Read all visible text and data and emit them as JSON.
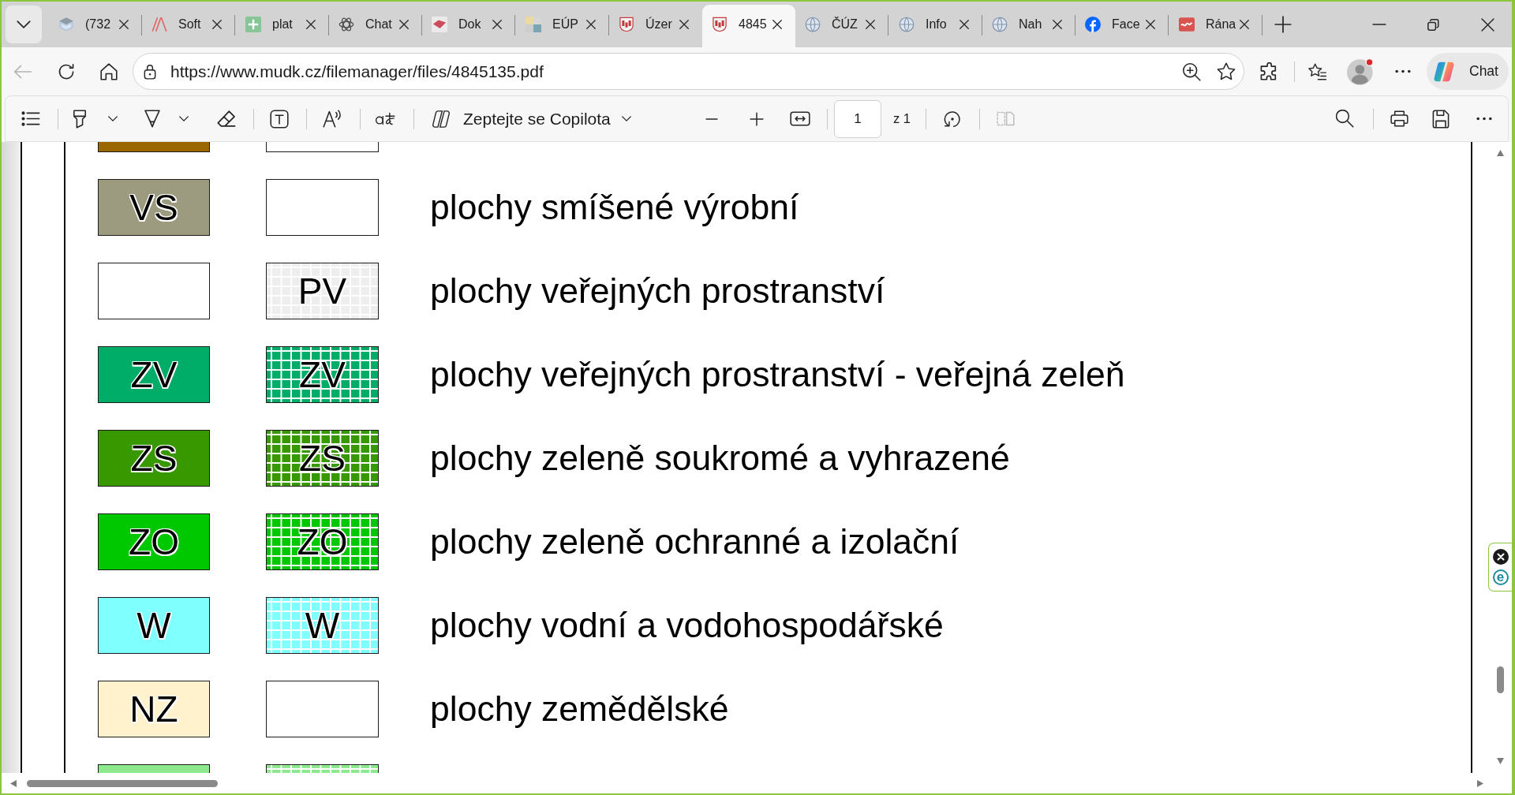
{
  "tabs": [
    {
      "title": "(732",
      "kind": "cube",
      "selected": false
    },
    {
      "title": "Soft",
      "kind": "stripes",
      "selected": false
    },
    {
      "title": "plat",
      "kind": "sheet",
      "selected": false
    },
    {
      "title": "Chat",
      "kind": "knot",
      "selected": false
    },
    {
      "title": "Dok",
      "kind": "wedge",
      "selected": false
    },
    {
      "title": "EÚP",
      "kind": "squares",
      "selected": false
    },
    {
      "title": "Úzer",
      "kind": "crest",
      "selected": false
    },
    {
      "title": "4845",
      "kind": "crest",
      "selected": true
    },
    {
      "title": "ČÚZ",
      "kind": "globe",
      "selected": false
    },
    {
      "title": "Info",
      "kind": "globe",
      "selected": false
    },
    {
      "title": "Nah",
      "kind": "globe",
      "selected": false
    },
    {
      "title": "Face",
      "kind": "f",
      "selected": false
    },
    {
      "title": "Rána",
      "kind": "tile",
      "selected": false
    }
  ],
  "address_bar": {
    "back_disabled": true,
    "url": "https://www.mudk.cz/filemanager/files/4845135.pdf"
  },
  "profile": {
    "notification": true
  },
  "chat_button": {
    "label": "Chat"
  },
  "pdf_toolbar": {
    "copilot_button": {
      "label": "Zeptejte se Copilota"
    },
    "page_field": {
      "value": "1"
    },
    "page_total": "z 1",
    "two_page_disabled": true
  },
  "legend": {
    "rows": [
      {
        "left_box": {
          "kind": "solid",
          "color": "#996600"
        },
        "right_box": {
          "kind": "blank"
        }
      },
      {
        "left_box": {
          "kind": "solid",
          "color": "#9c9a7f",
          "code": "VS"
        },
        "right_box": {
          "kind": "blank"
        },
        "label": "plochy smíšené výrobní"
      },
      {
        "left_box": {
          "kind": "blank"
        },
        "right_box": {
          "kind": "grid",
          "color": "#eeeeee",
          "code": "PV"
        },
        "label": "plochy veřejných prostranství"
      },
      {
        "left_box": {
          "kind": "solid",
          "color": "#00ad68",
          "code": "ZV"
        },
        "right_box": {
          "kind": "grid",
          "color": "#00ad68",
          "code": "ZV"
        },
        "label": "plochy veřejných prostranství - veřejná zeleň"
      },
      {
        "left_box": {
          "kind": "solid",
          "color": "#379800",
          "code": "ZS"
        },
        "right_box": {
          "kind": "grid",
          "color": "#379800",
          "code": "ZS"
        },
        "label": "plochy zeleně soukromé a vyhrazené"
      },
      {
        "left_box": {
          "kind": "solid",
          "color": "#00c800",
          "code": "ZO"
        },
        "right_box": {
          "kind": "grid",
          "color": "#00c800",
          "code": "ZO"
        },
        "label": "plochy zeleně ochranné a izolační"
      },
      {
        "left_box": {
          "kind": "solid",
          "color": "#80ffff",
          "code": "W"
        },
        "right_box": {
          "kind": "grid",
          "color": "#80ffff",
          "code": "W"
        },
        "label": "plochy vodní a vodohospodářské"
      },
      {
        "left_box": {
          "kind": "solid",
          "color": "#fff2cc",
          "code": "NZ"
        },
        "right_box": {
          "kind": "blank"
        },
        "label": "plochy zemědělské"
      },
      {
        "left_box": {
          "kind": "solid",
          "color": "#8ee88e"
        },
        "right_box": {
          "kind": "grid",
          "color": "#8ee88e"
        }
      }
    ]
  },
  "side_widget": {
    "badge": "e"
  }
}
